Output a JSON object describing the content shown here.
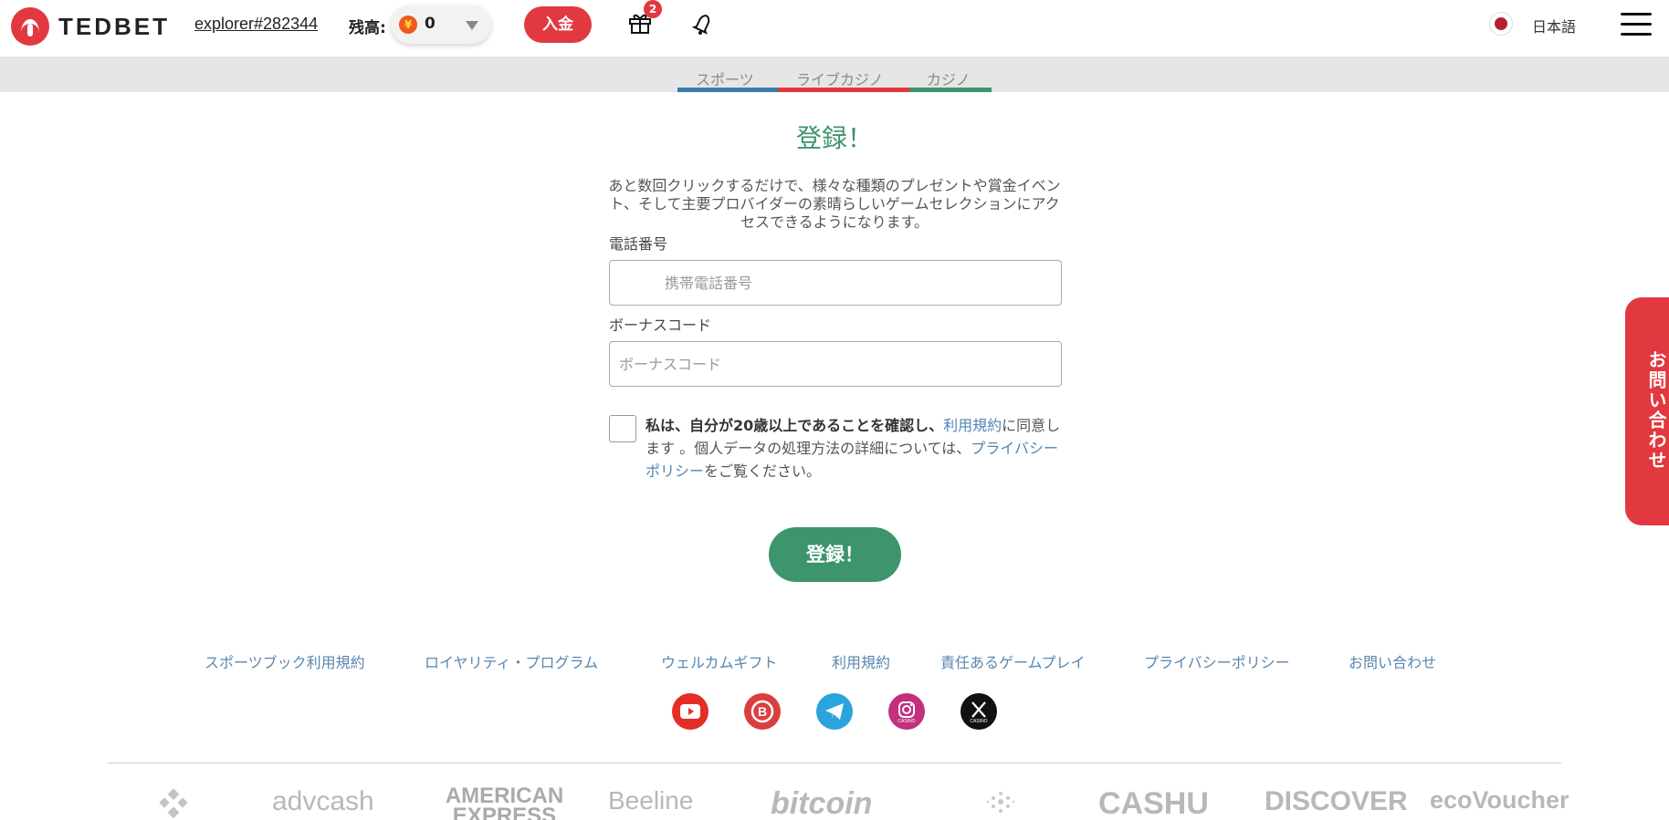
{
  "header": {
    "brand": "TEDBET",
    "username": "explorer#282344",
    "balance_label": "残高:",
    "currency_symbol": "¥",
    "balance_value": "0",
    "deposit_label": "入金",
    "gift_count": "2",
    "language": "日本語",
    "icons": [
      "tedbet-logo-icon",
      "yen-coin-icon",
      "caret-down-icon",
      "gift-icon",
      "bell-icon",
      "japan-flag-icon",
      "menu-icon"
    ]
  },
  "subnav": {
    "tabs": [
      {
        "label": "スポーツ",
        "color": "#3a7ea8"
      },
      {
        "label": "ライブカジノ",
        "color": "#e2383f"
      },
      {
        "label": "カジノ",
        "color": "#3d946d"
      }
    ]
  },
  "form": {
    "title": "登録！",
    "intro": "あと数回クリックするだけで、様々な種類のプレゼントや賞金イベント、そして主要プロバイダーの素晴らしいゲームセレクションにアクセスできるようになります。",
    "phone_label": "電話番号",
    "phone_placeholder": "携帯電話番号",
    "bonus_label": "ボーナスコード",
    "bonus_placeholder": "ボーナスコード",
    "consent_bold": "私は、自分が20歳以上であることを確認し、",
    "consent_terms_link": "利用規約",
    "consent_middle": "に同意します 。個人データの処理方法の詳細については、",
    "consent_privacy_link": "プライバシー ポリシー",
    "consent_end": "をご覧ください。",
    "submit_label": "登録！"
  },
  "contact_tab": {
    "label": "お問い合わせ"
  },
  "footer": {
    "links": [
      "スポーツブック利用規約",
      "ロイヤリティ・プログラム",
      "ウェルカムギフト",
      "利用規約",
      "責任あるゲームプレイ",
      "プライバシーポリシー",
      "お問い合わせ"
    ],
    "social": [
      {
        "icon": "youtube-icon",
        "color": "#e52d27"
      },
      {
        "icon": "bitcointalk-icon",
        "color": "#d93f3f"
      },
      {
        "icon": "telegram-icon",
        "color": "#2aa3df"
      },
      {
        "icon": "instagram-icon",
        "color": "#c2307e",
        "badge": "CASINO"
      },
      {
        "icon": "x-icon",
        "color": "#111111",
        "badge": "CASINO"
      }
    ],
    "payments": [
      {
        "icon": "binance-icon",
        "label": ""
      },
      {
        "icon": "advcash-icon",
        "label": "advcash"
      },
      {
        "icon": "amex-icon",
        "label": "AMERICAN EXPRESS"
      },
      {
        "icon": "beeline-icon",
        "label": "Beeline"
      },
      {
        "icon": "bitcoin-icon",
        "label": "bitcoin"
      },
      {
        "icon": "cardano-icon",
        "label": ""
      },
      {
        "icon": "cashu-icon",
        "label": "CASHU"
      },
      {
        "icon": "discover-icon",
        "label": "DISCOVER"
      },
      {
        "icon": "ecovoucher-icon",
        "label": "ecoVoucher"
      }
    ]
  }
}
